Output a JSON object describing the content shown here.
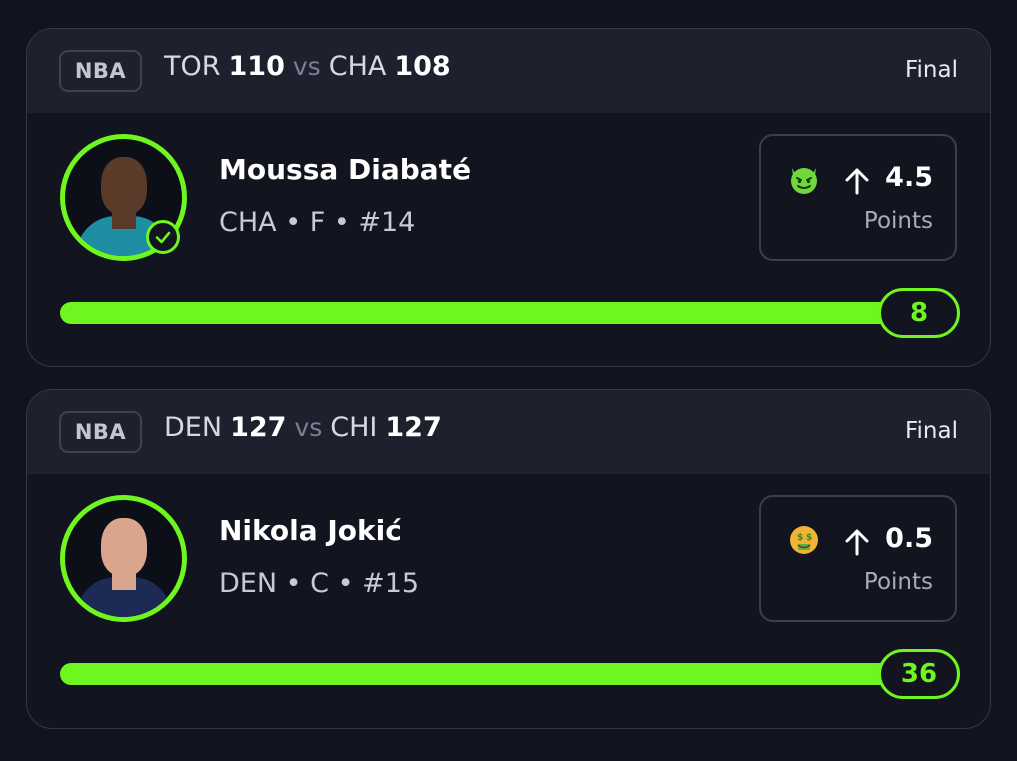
{
  "cards": [
    {
      "league": "NBA",
      "home_team": "TOR",
      "home_score": "110",
      "vs": "vs",
      "away_team": "CHA",
      "away_score": "108",
      "status": "Final",
      "player": {
        "name": "Moussa Diabaté",
        "meta": "CHA • F • #14",
        "verified": true
      },
      "line": {
        "emoji": "devil-face-icon",
        "direction": "up-arrow-icon",
        "value": "4.5",
        "stat": "Points"
      },
      "result": {
        "value": "8",
        "progress_percent": 100
      },
      "colors": {
        "jersey": "#1e8fa3",
        "skin": "#5a3a28"
      }
    },
    {
      "league": "NBA",
      "home_team": "DEN",
      "home_score": "127",
      "vs": "vs",
      "away_team": "CHI",
      "away_score": "127",
      "status": "Final",
      "player": {
        "name": "Nikola Jokić",
        "meta": "DEN • C • #15",
        "verified": false
      },
      "line": {
        "emoji": "money-mouth-face-icon",
        "direction": "up-arrow-icon",
        "value": "0.5",
        "stat": "Points"
      },
      "result": {
        "value": "36",
        "progress_percent": 100
      },
      "colors": {
        "jersey": "#1d2a55",
        "skin": "#d9a58c"
      }
    }
  ],
  "theme": {
    "accent": "#6ff51f",
    "background": "#111320",
    "header_bg": "#1e212d"
  }
}
